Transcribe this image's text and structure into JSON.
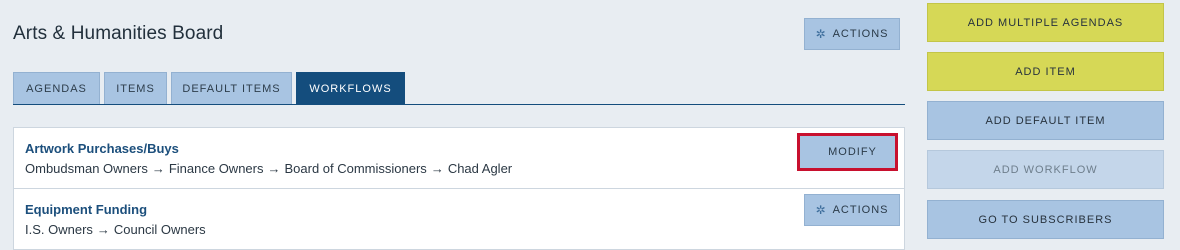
{
  "header": {
    "title": "Arts & Humanities Board",
    "actions_label": "ACTIONS"
  },
  "tabs": [
    {
      "label": "AGENDAS",
      "active": false
    },
    {
      "label": "ITEMS",
      "active": false
    },
    {
      "label": "DEFAULT ITEMS",
      "active": false
    },
    {
      "label": "WORKFLOWS",
      "active": true
    }
  ],
  "workflows": [
    {
      "name": "Artwork Purchases/Buys",
      "steps": [
        "Ombudsman Owners",
        "Finance Owners",
        "Board of Commissioners",
        "Chad Agler"
      ],
      "button_label": "MODIFY"
    },
    {
      "name": "Equipment Funding",
      "steps": [
        "I.S. Owners",
        "Council Owners"
      ],
      "button_label": "ACTIONS"
    }
  ],
  "arrow": "→",
  "sidebar": {
    "buttons": [
      {
        "label": "ADD MULTIPLE AGENDAS",
        "style": "yellow"
      },
      {
        "label": "ADD ITEM",
        "style": "yellow"
      },
      {
        "label": "ADD DEFAULT ITEM",
        "style": "blue"
      },
      {
        "label": "ADD WORKFLOW",
        "style": "disabled"
      },
      {
        "label": "GO TO SUBSCRIBERS",
        "style": "blue"
      }
    ]
  },
  "icons": {
    "gear": "gear-icon"
  },
  "colors": {
    "active_tab": "#144d7d",
    "button_blue": "#a8c4e2",
    "button_yellow": "#d6d856",
    "highlight_red": "#c8102e",
    "link_blue": "#1c4f7c"
  }
}
